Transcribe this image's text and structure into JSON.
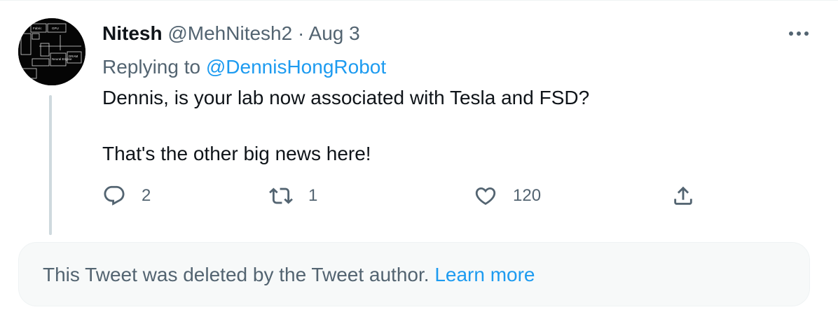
{
  "tweet": {
    "author_name": "Nitesh",
    "author_handle": "@MehNitesh2",
    "separator": "·",
    "date": "Aug 3",
    "replying_prefix": "Replying to",
    "replying_to": "@DennisHongRobot",
    "text_lines": [
      "Dennis, is your lab now associated with Tesla and FSD?",
      "That's the other big news here!"
    ],
    "avatar_labels": [
      "Fabric",
      "GPU",
      "Neural Engine",
      "DRAM"
    ]
  },
  "actions": {
    "reply": {
      "icon": "reply-bubble-icon",
      "count": "2"
    },
    "retweet": {
      "icon": "retweet-icon",
      "count": "1"
    },
    "like": {
      "icon": "heart-icon",
      "count": "120"
    },
    "share": {
      "icon": "share-upload-icon"
    }
  },
  "more_menu": {
    "icon": "more-dots-icon"
  },
  "deleted_notice": {
    "text": "This Tweet was deleted by the Tweet author.",
    "link": "Learn more"
  },
  "colors": {
    "text": "#0f1419",
    "muted": "#536471",
    "link": "#1d9bf0",
    "thread_line": "#cfd9de",
    "notice_bg": "#f7f9f9"
  }
}
